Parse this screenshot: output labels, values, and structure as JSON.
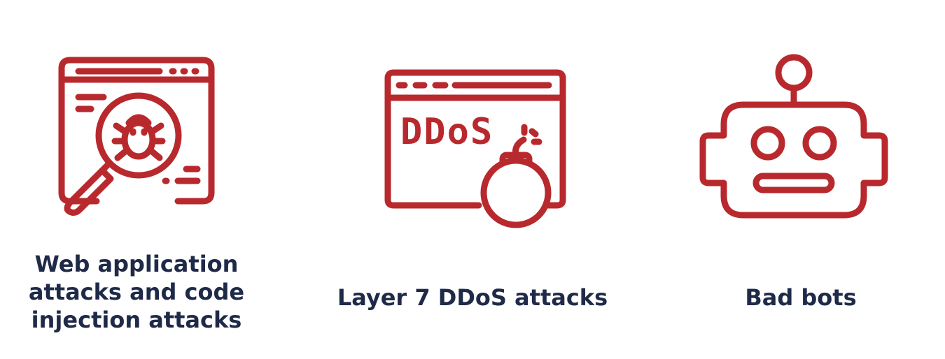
{
  "colors": {
    "icon": "#b8292e",
    "text": "#1f2a48",
    "background": "#ffffff"
  },
  "features": [
    {
      "icon": "bug-magnifier-browser-icon",
      "caption_lines": [
        "Web application",
        "attacks and code",
        "injection attacks"
      ]
    },
    {
      "icon": "ddos-bomb-browser-icon",
      "icon_text": "DDoS",
      "caption_lines": [
        "Layer 7 DDoS attacks"
      ]
    },
    {
      "icon": "robot-icon",
      "caption_lines": [
        "Bad bots"
      ]
    }
  ]
}
